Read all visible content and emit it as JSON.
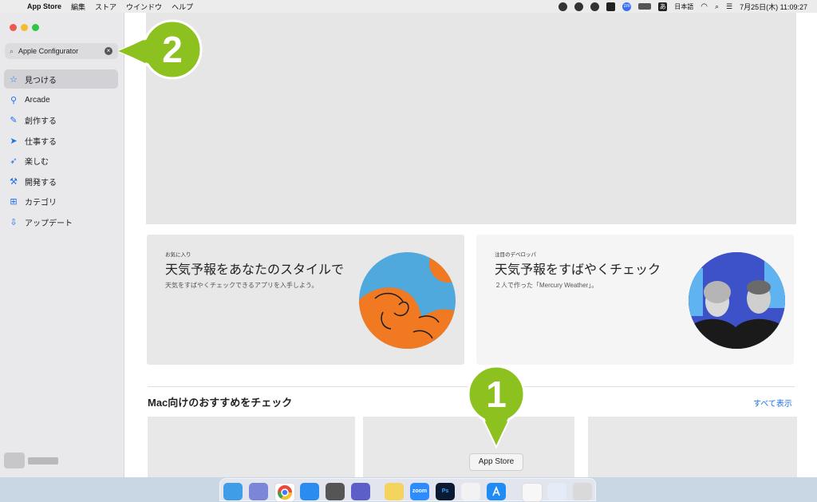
{
  "menubar": {
    "app_name": "App Store",
    "items": [
      "編集",
      "ストア",
      "ウインドウ",
      "ヘルプ"
    ],
    "input_label": "日本語",
    "ime": "あ",
    "zoom": "zm",
    "clock": "7月25日(木) 11:09:27"
  },
  "sidebar": {
    "search_value": "Apple Configurator",
    "items": [
      {
        "label": "見つける",
        "icon": "star-icon"
      },
      {
        "label": "Arcade",
        "icon": "joystick-icon"
      },
      {
        "label": "創作する",
        "icon": "brush-icon"
      },
      {
        "label": "仕事する",
        "icon": "paper-plane-icon"
      },
      {
        "label": "楽しむ",
        "icon": "rocket-icon"
      },
      {
        "label": "開発する",
        "icon": "hammer-icon"
      },
      {
        "label": "カテゴリ",
        "icon": "grid-icon"
      },
      {
        "label": "アップデート",
        "icon": "download-icon"
      }
    ]
  },
  "cards": [
    {
      "tag": "お気に入り",
      "title": "天気予報をあなたのスタイルで",
      "desc": "天気をすばやくチェックできるアプリを入手しよう。"
    },
    {
      "tag": "注目のデベロッパ",
      "title": "天気予報をすばやくチェック",
      "desc": "２人で作った「Mercury Weather」。"
    }
  ],
  "section": {
    "title": "Mac向けのおすすめをチェック",
    "show_all": "すべて表示"
  },
  "dock": {
    "tooltip": "App Store",
    "apps": [
      {
        "name": "finder-icon",
        "label": ""
      },
      {
        "name": "launchpad-icon",
        "label": ""
      },
      {
        "name": "chrome-icon",
        "label": ""
      },
      {
        "name": "safari-icon",
        "label": ""
      },
      {
        "name": "calculator-icon",
        "label": ""
      },
      {
        "name": "teams-icon",
        "label": ""
      },
      {
        "name": "notes-icon",
        "label": ""
      },
      {
        "name": "zoom-icon",
        "label": "zoom"
      },
      {
        "name": "photoshop-icon",
        "label": "Ps"
      },
      {
        "name": "app-icon",
        "label": ""
      },
      {
        "name": "app-store-icon",
        "label": ""
      },
      {
        "name": "document-icon",
        "label": ""
      },
      {
        "name": "preview-icon",
        "label": ""
      },
      {
        "name": "trash-icon",
        "label": ""
      }
    ]
  },
  "callouts": [
    {
      "number": "2",
      "color": "#8cc11f"
    },
    {
      "number": "1",
      "color": "#8cc11f"
    }
  ],
  "colors": {
    "accent": "#1a6ff0",
    "card1_bg": "#e8e8e8",
    "card2_bg": "#f5f5f5",
    "art_orange": "#f07922",
    "art_blue": "#4fa9dc"
  }
}
